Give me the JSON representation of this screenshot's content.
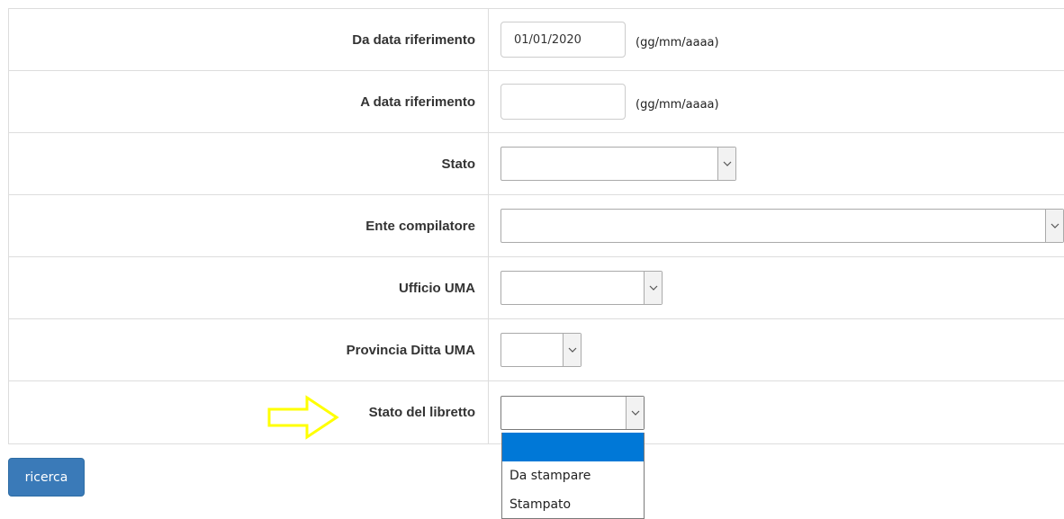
{
  "form": {
    "da_data": {
      "label": "Da data riferimento",
      "value": "01/01/2020",
      "hint": "(gg/mm/aaaa)"
    },
    "a_data": {
      "label": "A data riferimento",
      "value": "",
      "hint": "(gg/mm/aaaa)"
    },
    "stato": {
      "label": "Stato",
      "selected": ""
    },
    "ente": {
      "label": "Ente compilatore",
      "selected": ""
    },
    "ufficio": {
      "label": "Ufficio UMA",
      "selected": ""
    },
    "provincia": {
      "label": "Provincia Ditta UMA",
      "selected": ""
    },
    "stato_libretto": {
      "label": "Stato del libretto",
      "selected": "",
      "options": [
        "",
        "Da stampare",
        "Stampato"
      ]
    }
  },
  "actions": {
    "search_label": "ricerca"
  },
  "colors": {
    "accent": "#3a7ab8",
    "highlight": "#0078d7",
    "annotation_arrow": "#ffff00",
    "border": "#dddddd"
  },
  "icons": {
    "select_arrow": "chevron-down-icon",
    "annotation": "arrow-right-icon"
  }
}
